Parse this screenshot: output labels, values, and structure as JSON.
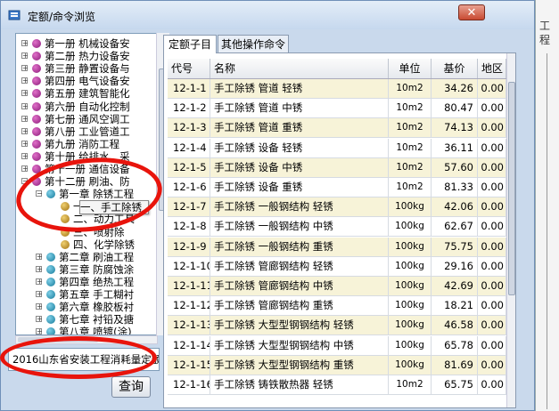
{
  "window": {
    "title": "定额/命令浏览",
    "close_label": "✕"
  },
  "background_right": {
    "line1": "工",
    "line2": "程"
  },
  "tree": [
    {
      "level": 0,
      "expand": "+",
      "icon": "book",
      "label": "第一册 机械设备安"
    },
    {
      "level": 0,
      "expand": "+",
      "icon": "book",
      "label": "第二册 热力设备安"
    },
    {
      "level": 0,
      "expand": "+",
      "icon": "book",
      "label": "第三册 静置设备与"
    },
    {
      "level": 0,
      "expand": "+",
      "icon": "book",
      "label": "第四册 电气设备安"
    },
    {
      "level": 0,
      "expand": "+",
      "icon": "book",
      "label": "第五册 建筑智能化"
    },
    {
      "level": 0,
      "expand": "+",
      "icon": "book",
      "label": "第六册 自动化控制"
    },
    {
      "level": 0,
      "expand": "+",
      "icon": "book",
      "label": "第七册 通风空调工"
    },
    {
      "level": 0,
      "expand": "+",
      "icon": "book",
      "label": "第八册 工业管道工"
    },
    {
      "level": 0,
      "expand": "+",
      "icon": "book",
      "label": "第九册 消防工程"
    },
    {
      "level": 0,
      "expand": "+",
      "icon": "book",
      "label": "第十册 给排水、采"
    },
    {
      "level": 0,
      "expand": "+",
      "icon": "book",
      "label": "第十一册 通信设备"
    },
    {
      "level": 0,
      "expand": "−",
      "icon": "book",
      "label": "第十二册 刷油、防"
    },
    {
      "level": 1,
      "expand": "−",
      "icon": "chapter",
      "label": "第一章 除锈工程"
    },
    {
      "level": 2,
      "expand": "",
      "icon": "section",
      "label": "一、手工除锈"
    },
    {
      "level": 2,
      "expand": "",
      "icon": "section",
      "label": "二、动力工具"
    },
    {
      "level": 2,
      "expand": "",
      "icon": "section",
      "label": "三、喷射除"
    },
    {
      "level": 2,
      "expand": "",
      "icon": "section",
      "label": "四、化学除锈"
    },
    {
      "level": 1,
      "expand": "+",
      "icon": "chapter",
      "label": "第二章 刷油工程"
    },
    {
      "level": 1,
      "expand": "+",
      "icon": "chapter",
      "label": "第三章 防腐蚀涂"
    },
    {
      "level": 1,
      "expand": "+",
      "icon": "chapter",
      "label": "第四章 绝热工程"
    },
    {
      "level": 1,
      "expand": "+",
      "icon": "chapter",
      "label": "第五章 手工糊衬"
    },
    {
      "level": 1,
      "expand": "+",
      "icon": "chapter",
      "label": "第六章 橡胶板衬"
    },
    {
      "level": 1,
      "expand": "+",
      "icon": "chapter",
      "label": "第七章 衬铅及搪"
    },
    {
      "level": 1,
      "expand": "+",
      "icon": "chapter",
      "label": "第八章 喷镀(涂)"
    }
  ],
  "tooltip": "一、手工除锈",
  "search": {
    "value": "2016山东省安装工程消耗量定额",
    "button": "查询"
  },
  "tabs": [
    {
      "label": "定额子目"
    },
    {
      "label": "其他操作命令"
    }
  ],
  "grid": {
    "columns": [
      "代号",
      "名称",
      "单位",
      "基价",
      "地区"
    ],
    "rows": [
      {
        "code": "12-1-1",
        "name": "手工除锈 管道 轻锈",
        "unit": "10m2",
        "price": "34.26",
        "region": "0.00"
      },
      {
        "code": "12-1-2",
        "name": "手工除锈 管道 中锈",
        "unit": "10m2",
        "price": "80.47",
        "region": "0.00"
      },
      {
        "code": "12-1-3",
        "name": "手工除锈 管道 重锈",
        "unit": "10m2",
        "price": "74.13",
        "region": "0.00"
      },
      {
        "code": "12-1-4",
        "name": "手工除锈 设备 轻锈",
        "unit": "10m2",
        "price": "36.11",
        "region": "0.00"
      },
      {
        "code": "12-1-5",
        "name": "手工除锈 设备 中锈",
        "unit": "10m2",
        "price": "57.60",
        "region": "0.00"
      },
      {
        "code": "12-1-6",
        "name": "手工除锈 设备 重锈",
        "unit": "10m2",
        "price": "81.33",
        "region": "0.00"
      },
      {
        "code": "12-1-7",
        "name": "手工除锈 一般钢结构 轻锈",
        "unit": "100kg",
        "price": "42.06",
        "region": "0.00"
      },
      {
        "code": "12-1-8",
        "name": "手工除锈 一般钢结构 中锈",
        "unit": "100kg",
        "price": "62.67",
        "region": "0.00"
      },
      {
        "code": "12-1-9",
        "name": "手工除锈 一般钢结构 重锈",
        "unit": "100kg",
        "price": "75.75",
        "region": "0.00"
      },
      {
        "code": "12-1-10",
        "name": "手工除锈 管廊钢结构 轻锈",
        "unit": "100kg",
        "price": "29.16",
        "region": "0.00"
      },
      {
        "code": "12-1-11",
        "name": "手工除锈 管廊钢结构 中锈",
        "unit": "100kg",
        "price": "42.69",
        "region": "0.00"
      },
      {
        "code": "12-1-12",
        "name": "手工除锈 管廊钢结构 重锈",
        "unit": "100kg",
        "price": "18.21",
        "region": "0.00"
      },
      {
        "code": "12-1-13",
        "name": "手工除锈 大型型钢钢结构 轻锈",
        "unit": "100kg",
        "price": "46.58",
        "region": "0.00"
      },
      {
        "code": "12-1-14",
        "name": "手工除锈 大型型钢钢结构 中锈",
        "unit": "100kg",
        "price": "65.78",
        "region": "0.00"
      },
      {
        "code": "12-1-15",
        "name": "手工除锈 大型型钢钢结构 重锈",
        "unit": "100kg",
        "price": "81.69",
        "region": "0.00"
      },
      {
        "code": "12-1-16",
        "name": "手工除锈 铸铁散热器 轻锈",
        "unit": "10m2",
        "price": "65.75",
        "region": "0.00"
      }
    ]
  },
  "colors": {
    "annotation": "#e8140c",
    "row_highlight": "#f7f3d8"
  }
}
